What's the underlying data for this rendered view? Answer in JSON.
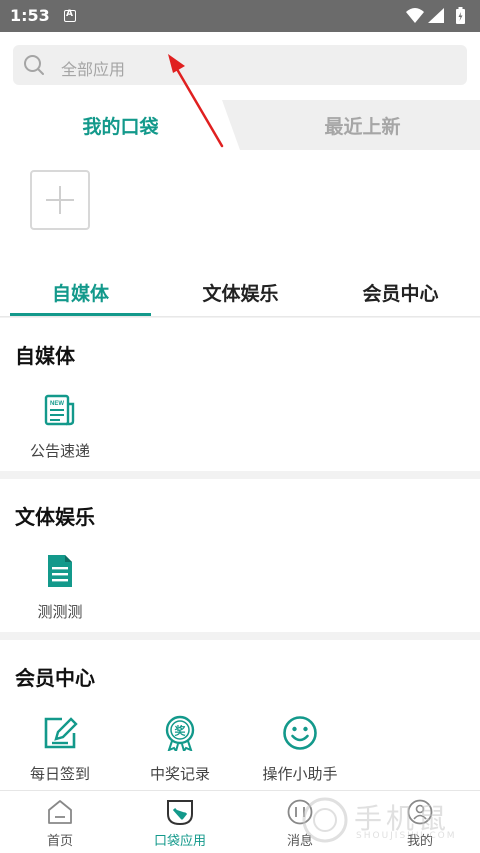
{
  "status_bar": {
    "time": "1:53"
  },
  "search": {
    "placeholder": "全部应用"
  },
  "pocket_tabs": {
    "mine": "我的口袋",
    "newest": "最近上新"
  },
  "category_tabs": [
    "自媒体",
    "文体娱乐",
    "会员中心"
  ],
  "sections": [
    {
      "title": "自媒体",
      "apps": [
        {
          "label": "公告速递",
          "icon": "newspaper-icon"
        }
      ]
    },
    {
      "title": "文体娱乐",
      "apps": [
        {
          "label": "测测测",
          "icon": "document-icon"
        }
      ]
    },
    {
      "title": "会员中心",
      "apps": [
        {
          "label": "每日签到",
          "icon": "sign-in-edit-icon"
        },
        {
          "label": "中奖记录",
          "icon": "prize-medal-icon",
          "icon_text": "奖"
        },
        {
          "label": "操作小助手",
          "icon": "smiley-icon"
        }
      ]
    }
  ],
  "tabbar": [
    {
      "label": "首页",
      "icon": "home-icon"
    },
    {
      "label": "口袋应用",
      "icon": "pocket-icon",
      "active": true
    },
    {
      "label": "消息",
      "icon": "message-icon"
    },
    {
      "label": "我的",
      "icon": "profile-icon"
    }
  ],
  "watermark": {
    "text": "手机鼠",
    "sub": "SHOUJISHU.COM"
  },
  "colors": {
    "accent": "#13998b",
    "arrow": "#e02020",
    "statusbar": "#6b6b6b"
  }
}
